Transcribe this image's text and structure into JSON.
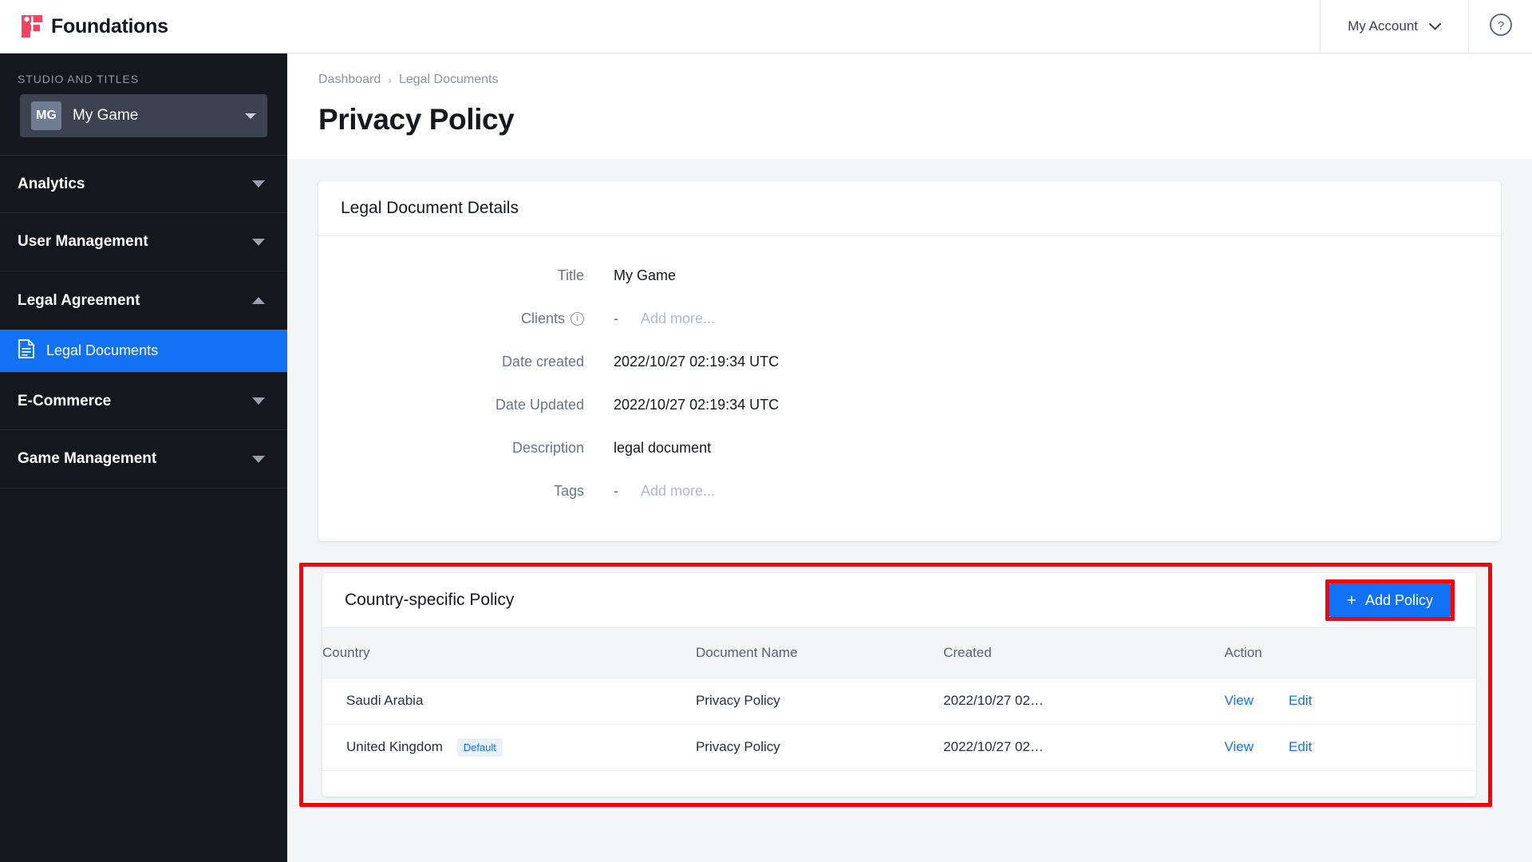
{
  "app": {
    "brand_name": "Foundations",
    "logo_icon": "foundations-logo-icon",
    "logo_color": "#f2435f"
  },
  "topbar": {
    "account_label": "My Account",
    "account_caret_icon": "chevron-down-icon",
    "help_icon": "help-circle-icon"
  },
  "sidebar": {
    "section_label": "STUDIO AND TITLES",
    "studio": {
      "initials": "MG",
      "name": "My Game",
      "caret_icon": "chevron-down-icon"
    },
    "groups": [
      {
        "label": "Analytics",
        "caret_icon": "caret-down-icon",
        "expanded": false
      },
      {
        "label": "User Management",
        "caret_icon": "caret-down-icon",
        "expanded": false
      },
      {
        "label": "Legal Agreement",
        "caret_icon": "caret-up-icon",
        "expanded": true
      },
      {
        "label": "E-Commerce",
        "caret_icon": "caret-down-icon",
        "expanded": false
      },
      {
        "label": "Game Management",
        "caret_icon": "caret-down-icon",
        "expanded": false
      }
    ],
    "sub_items": [
      {
        "label": "Legal Documents",
        "icon": "document-icon",
        "active": true
      }
    ],
    "active_color": "#1272f5"
  },
  "breadcrumb": {
    "items": [
      "Dashboard",
      "Legal Documents"
    ],
    "separator": "›"
  },
  "page": {
    "title": "Privacy Policy"
  },
  "details_card": {
    "title": "Legal Document Details",
    "rows": [
      {
        "label": "Title",
        "value": "My Game"
      },
      {
        "label": "Clients",
        "value": "-",
        "info_icon": "info-icon",
        "placeholder": "Add more..."
      },
      {
        "label": "Date created",
        "value": "2022/10/27 02:19:34 UTC"
      },
      {
        "label": "Date Updated",
        "value": "2022/10/27 02:19:34 UTC"
      },
      {
        "label": "Description",
        "value": "legal document"
      },
      {
        "label": "Tags",
        "value": "-",
        "placeholder": "Add more..."
      }
    ]
  },
  "policy_card": {
    "title": "Country-specific Policy",
    "add_button": {
      "label": "Add Policy",
      "icon": "plus-icon",
      "color": "#1272f5"
    },
    "highlight_color": "#fb0007",
    "columns": [
      "Country",
      "Document Name",
      "Created",
      "Action"
    ],
    "rows": [
      {
        "country": "Saudi Arabia",
        "badge": "",
        "document_name": "Privacy Policy",
        "created": "2022/10/27 02…",
        "view_label": "View",
        "edit_label": "Edit"
      },
      {
        "country": "United Kingdom",
        "badge": "Default",
        "document_name": "Privacy Policy",
        "created": "2022/10/27 02…",
        "view_label": "View",
        "edit_label": "Edit"
      }
    ]
  }
}
